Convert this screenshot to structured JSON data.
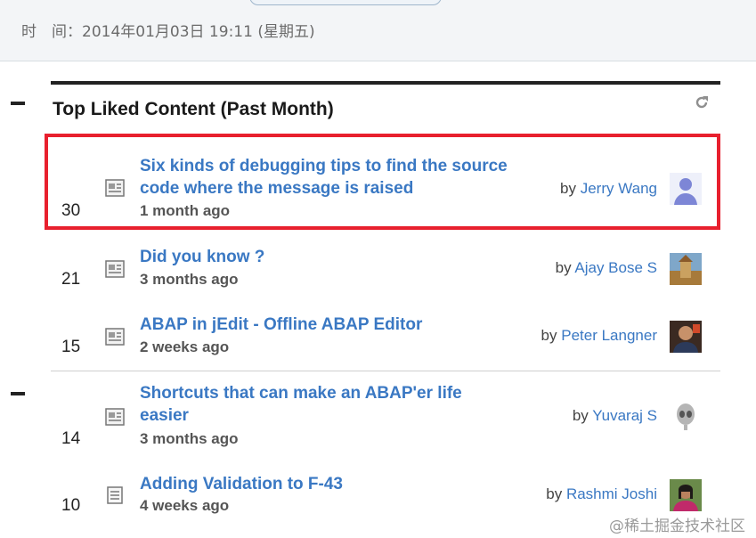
{
  "meta": {
    "time_line": "时　间：2014年01月03日 19:11 (星期五)"
  },
  "panel": {
    "title": "Top Liked Content (Past Month)",
    "refresh_icon": "refresh-icon"
  },
  "items": [
    {
      "count": "30",
      "title": "Six kinds of debugging tips to find the source code where the message is raised",
      "age": "1 month ago",
      "by": "by",
      "author": "Jerry Wang",
      "doc_icon": "blog-post-icon",
      "avatar": "default-user-avatar"
    },
    {
      "count": "21",
      "title": "Did you know ?",
      "age": "3 months ago",
      "by": "by",
      "author": "Ajay Bose S",
      "doc_icon": "blog-post-icon",
      "avatar": "photo-avatar"
    },
    {
      "count": "15",
      "title": "ABAP in jEdit - Offline ABAP Editor",
      "age": "2 weeks ago",
      "by": "by",
      "author": "Peter Langner",
      "doc_icon": "blog-post-icon",
      "avatar": "photo-avatar"
    },
    {
      "count": "14",
      "title": "Shortcuts that can make an ABAP'er life easier",
      "age": "3 months ago",
      "by": "by",
      "author": "Yuvaraj S",
      "doc_icon": "blog-post-icon",
      "avatar": "alien-avatar"
    },
    {
      "count": "10",
      "title": "Adding Validation to F-43",
      "age": "4 weeks ago",
      "by": "by",
      "author": "Rashmi Joshi",
      "doc_icon": "document-icon",
      "avatar": "photo-avatar"
    }
  ],
  "watermark": "@稀土掘金技术社区",
  "colors": {
    "link": "#3a78c3",
    "highlight": "#e8202e"
  }
}
